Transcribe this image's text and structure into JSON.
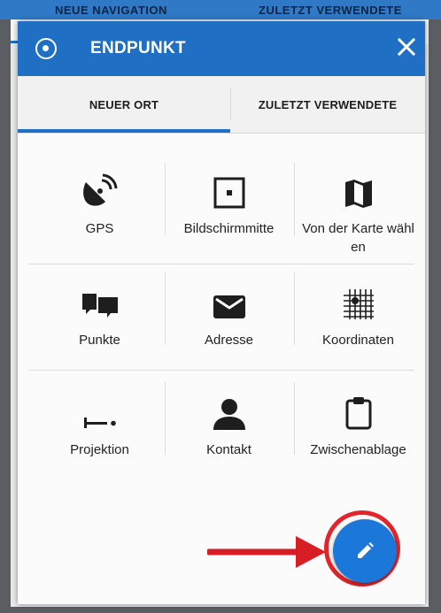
{
  "background": {
    "tabs": [
      "NEUE NAVIGATION",
      "ZULETZT VERWENDETE"
    ]
  },
  "dialog": {
    "title": "ENDPUNKT",
    "header_icon": "target-icon",
    "close_icon": "close-icon",
    "tabs": [
      {
        "label": "NEUER ORT",
        "active": true
      },
      {
        "label": "ZULETZT VERWENDETE",
        "active": false
      }
    ],
    "options": [
      {
        "label": "GPS",
        "icon": "satellite-dish-icon"
      },
      {
        "label": "Bildschirmmitte",
        "icon": "screen-center-icon"
      },
      {
        "label": "Von der Karte wählen",
        "icon": "map-icon"
      },
      {
        "label": "Punkte",
        "icon": "points-icon"
      },
      {
        "label": "Adresse",
        "icon": "envelope-icon"
      },
      {
        "label": "Koordinaten",
        "icon": "grid-coordinates-icon"
      },
      {
        "label": "Projektion",
        "icon": "projection-icon"
      },
      {
        "label": "Kontakt",
        "icon": "contact-icon"
      },
      {
        "label": "Zwischenablage",
        "icon": "clipboard-icon"
      }
    ],
    "fab_icon": "pencil-icon"
  },
  "colors": {
    "primary": "#1f6fc5",
    "fab": "#1c78d8",
    "annotation": "#e2252b"
  }
}
